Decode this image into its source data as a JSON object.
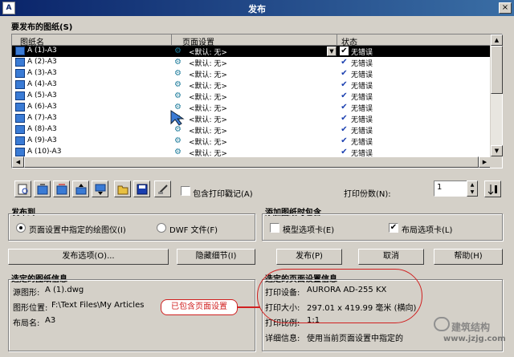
{
  "window": {
    "title": "发布",
    "app_icon": "autocad-icon",
    "close_label": "×"
  },
  "sheets_section": {
    "label": "要发布的图纸(S)"
  },
  "list": {
    "headers": {
      "name": "图纸名",
      "page_setup": "页面设置",
      "status": "状态"
    },
    "rows": [
      {
        "name": "A (1)-A3",
        "page_setup": "<默认: 无>",
        "status": "无错误",
        "selected": true
      },
      {
        "name": "A (2)-A3",
        "page_setup": "<默认: 无>",
        "status": "无错误"
      },
      {
        "name": "A (3)-A3",
        "page_setup": "<默认: 无>",
        "status": "无错误"
      },
      {
        "name": "A (4)-A3",
        "page_setup": "<默认: 无>",
        "status": "无错误"
      },
      {
        "name": "A (5)-A3",
        "page_setup": "<默认: 无>",
        "status": "无错误"
      },
      {
        "name": "A (6)-A3",
        "page_setup": "<默认: 无>",
        "status": "无错误"
      },
      {
        "name": "A (7)-A3",
        "page_setup": "<默认: 无>",
        "status": "无错误"
      },
      {
        "name": "A (8)-A3",
        "page_setup": "<默认: 无>",
        "status": "无错误"
      },
      {
        "name": "A (9)-A3",
        "page_setup": "<默认: 无>",
        "status": "无错误"
      },
      {
        "name": "A (10)-A3",
        "page_setup": "<默认: 无>",
        "status": "无错误"
      }
    ]
  },
  "toolbar": {
    "include_stamp_label": "包含打印戳记(A)",
    "copies_label": "打印份数(N):",
    "copies_value": "1"
  },
  "publish_to": {
    "label": "发布到",
    "plotter_option": "页面设置中指定的绘图仪(I)",
    "dwf_option": "DWF 文件(F)"
  },
  "add_sheets": {
    "label": "添加图纸时包含",
    "model_tab": "模型选项卡(E)",
    "layout_tab": "布局选项卡(L)"
  },
  "buttons": {
    "publish_options": "发布选项(O)...",
    "hide_details": "隐藏细节(I)",
    "publish": "发布(P)",
    "cancel": "取消",
    "help": "帮助(H)"
  },
  "sheet_info": {
    "label": "选定的图纸信息",
    "source_label": "源图形:",
    "source_value": "A (1).dwg",
    "location_label": "图形位置:",
    "location_value": "F:\\Text Files\\My Articles",
    "layout_label": "布局名:",
    "layout_value": "A3"
  },
  "page_setup_info": {
    "label": "选定的页面设置信息",
    "device_label": "打印设备:",
    "device_value": "AURORA AD-255 KX",
    "size_label": "打印大小:",
    "size_value": "297.01 x 419.99 毫米 (横向)",
    "scale_label": "打印比例:",
    "scale_value": "1:1",
    "details_label": "详细信息:",
    "details_value": "使用当前页面设置中指定的"
  },
  "annotation": {
    "text": "已包含页面设置",
    "color": "#d02020"
  },
  "watermark": {
    "text": "建筑结构",
    "url": "www.jzjg.com"
  }
}
